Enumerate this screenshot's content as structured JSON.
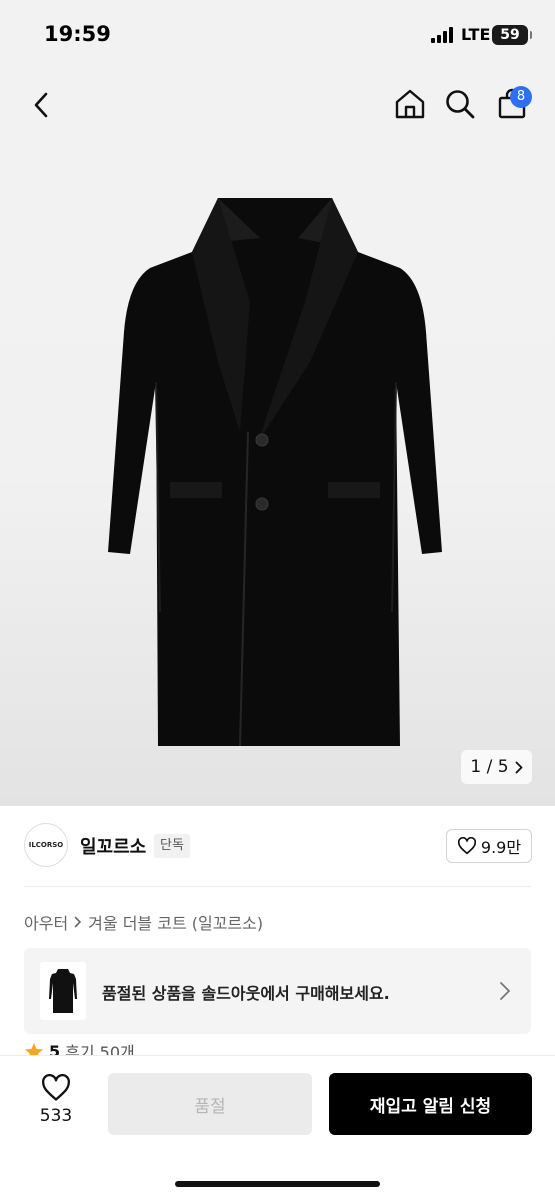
{
  "status_bar": {
    "time": "19:59",
    "network": "LTE",
    "battery": "59"
  },
  "header": {
    "cart_count": "8",
    "icons": [
      "back-icon",
      "home-icon",
      "search-icon",
      "cart-icon"
    ]
  },
  "gallery": {
    "counter": "1 / 5"
  },
  "brand": {
    "logo_text": "ILCORSO",
    "name": "일꼬르소",
    "badge": "단독",
    "likes": "9.9만"
  },
  "breadcrumb": {
    "category": "아우터",
    "product": "겨울 더블 코트 (일꼬르소)"
  },
  "soldout_banner": {
    "text": "품절된 상품을 솔드아웃에서 구매해보세요."
  },
  "rating": {
    "score": "5",
    "reviews": "후기 50개"
  },
  "bottom_bar": {
    "like_count": "533",
    "soldout_label": "품절",
    "restock_label": "재입고 알림 신청"
  },
  "colors": {
    "badge_blue": "#2f6ff5",
    "star": "#f5a623",
    "primary_button": "#000000"
  }
}
